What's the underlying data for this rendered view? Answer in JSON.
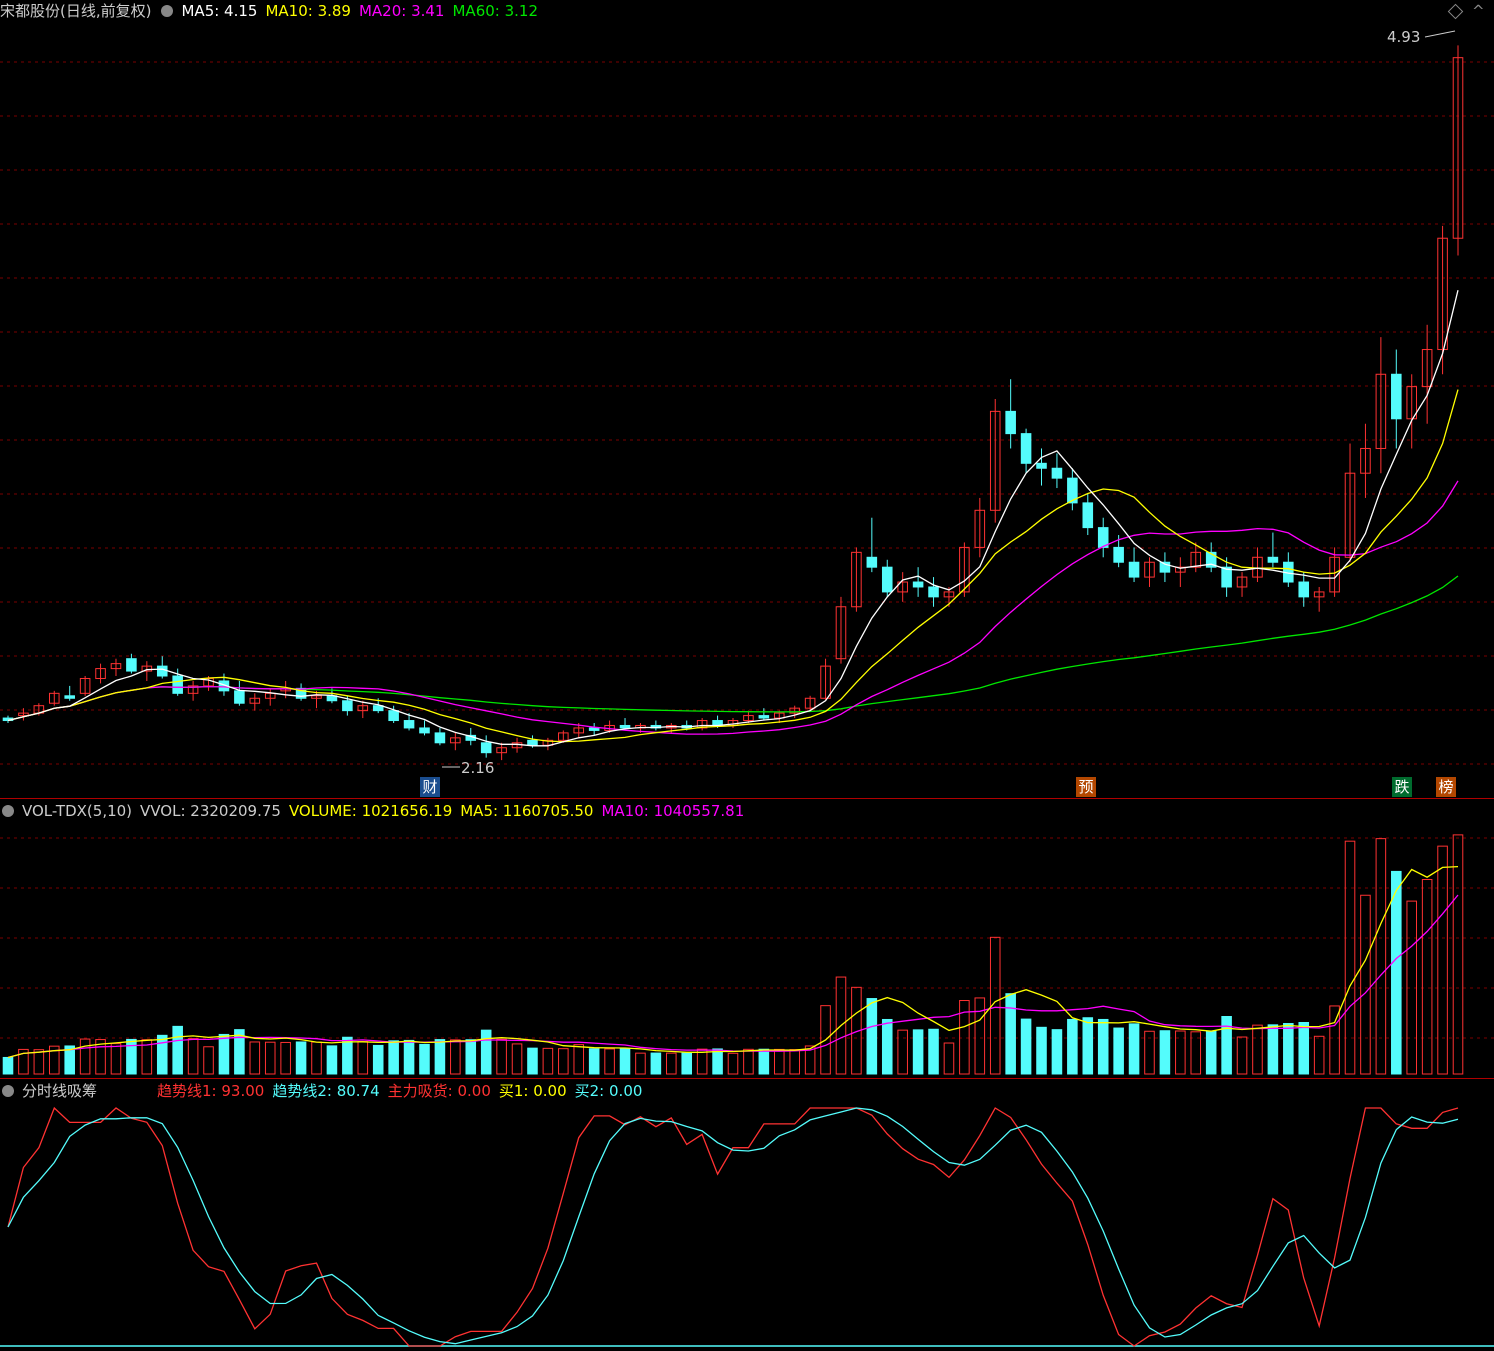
{
  "main": {
    "title": "宋都股份(日线,前复权)",
    "ma5_label": "MA5: 4.15",
    "ma10_label": "MA10: 3.89",
    "ma20_label": "MA20: 3.41",
    "ma60_label": "MA60: 3.12",
    "high_label": "4.93",
    "low_label": "2.16",
    "tag_cai": "财",
    "tag_yu": "预",
    "tag_die": "跌",
    "tag_bang": "榜",
    "colors": {
      "up": "#ff3232",
      "down": "#54fcfc",
      "ma5": "#ffffff",
      "ma10": "#ffff00",
      "ma20": "#ff00ff",
      "ma60": "#00e600",
      "grid": "#7a0000"
    }
  },
  "volume": {
    "name": "VOL-TDX(5,10)",
    "vvol_label": "VVOL: 2320209.75",
    "volume_label": "VOLUME: 1021656.19",
    "ma5_label": "MA5: 1160705.50",
    "ma10_label": "MA10: 1040557.81"
  },
  "indicator": {
    "name": "分时线吸筹",
    "trend1_label": "趋势线1: 93.00",
    "trend2_label": "趋势线2: 80.74",
    "accum_label": "主力吸货: 0.00",
    "buy1_label": "买1: 0.00",
    "buy2_label": "买2: 0.00"
  },
  "chart_data": {
    "type": "candlestick",
    "price_range": [
      2.0,
      5.0
    ],
    "candles": [
      [
        2.21,
        2.22,
        2.19,
        2.2
      ],
      [
        2.22,
        2.25,
        2.2,
        2.23
      ],
      [
        2.23,
        2.27,
        2.22,
        2.26
      ],
      [
        2.27,
        2.32,
        2.26,
        2.31
      ],
      [
        2.3,
        2.34,
        2.28,
        2.29
      ],
      [
        2.31,
        2.38,
        2.3,
        2.37
      ],
      [
        2.37,
        2.43,
        2.35,
        2.41
      ],
      [
        2.41,
        2.45,
        2.38,
        2.43
      ],
      [
        2.45,
        2.47,
        2.39,
        2.4
      ],
      [
        2.4,
        2.44,
        2.36,
        2.42
      ],
      [
        2.42,
        2.46,
        2.37,
        2.38
      ],
      [
        2.38,
        2.41,
        2.3,
        2.31
      ],
      [
        2.31,
        2.36,
        2.28,
        2.34
      ],
      [
        2.34,
        2.38,
        2.32,
        2.37
      ],
      [
        2.36,
        2.39,
        2.3,
        2.32
      ],
      [
        2.32,
        2.36,
        2.26,
        2.27
      ],
      [
        2.27,
        2.31,
        2.24,
        2.29
      ],
      [
        2.29,
        2.33,
        2.26,
        2.31
      ],
      [
        2.32,
        2.36,
        2.29,
        2.33
      ],
      [
        2.33,
        2.35,
        2.28,
        2.29
      ],
      [
        2.29,
        2.32,
        2.25,
        2.3
      ],
      [
        2.3,
        2.33,
        2.27,
        2.28
      ],
      [
        2.28,
        2.3,
        2.22,
        2.24
      ],
      [
        2.24,
        2.28,
        2.21,
        2.26
      ],
      [
        2.26,
        2.29,
        2.23,
        2.24
      ],
      [
        2.24,
        2.26,
        2.19,
        2.2
      ],
      [
        2.2,
        2.23,
        2.16,
        2.17
      ],
      [
        2.17,
        2.2,
        2.14,
        2.15
      ],
      [
        2.15,
        2.17,
        2.1,
        2.11
      ],
      [
        2.11,
        2.15,
        2.08,
        2.13
      ],
      [
        2.14,
        2.17,
        2.1,
        2.12
      ],
      [
        2.11,
        2.14,
        2.05,
        2.07
      ],
      [
        2.07,
        2.11,
        2.04,
        2.09
      ],
      [
        2.09,
        2.13,
        2.07,
        2.11
      ],
      [
        2.12,
        2.14,
        2.09,
        2.1
      ],
      [
        2.1,
        2.13,
        2.08,
        2.12
      ],
      [
        2.12,
        2.16,
        2.11,
        2.15
      ],
      [
        2.15,
        2.19,
        2.13,
        2.17
      ],
      [
        2.17,
        2.19,
        2.14,
        2.16
      ],
      [
        2.16,
        2.2,
        2.15,
        2.18
      ],
      [
        2.18,
        2.21,
        2.16,
        2.17
      ],
      [
        2.17,
        2.19,
        2.15,
        2.18
      ],
      [
        2.18,
        2.2,
        2.16,
        2.17
      ],
      [
        2.17,
        2.19,
        2.15,
        2.18
      ],
      [
        2.18,
        2.2,
        2.16,
        2.17
      ],
      [
        2.17,
        2.21,
        2.16,
        2.2
      ],
      [
        2.2,
        2.22,
        2.17,
        2.18
      ],
      [
        2.18,
        2.21,
        2.17,
        2.2
      ],
      [
        2.2,
        2.24,
        2.19,
        2.22
      ],
      [
        2.22,
        2.25,
        2.2,
        2.21
      ],
      [
        2.21,
        2.24,
        2.19,
        2.23
      ],
      [
        2.23,
        2.26,
        2.21,
        2.25
      ],
      [
        2.25,
        2.3,
        2.24,
        2.29
      ],
      [
        2.29,
        2.45,
        2.28,
        2.42
      ],
      [
        2.45,
        2.7,
        2.43,
        2.66
      ],
      [
        2.66,
        2.9,
        2.64,
        2.88
      ],
      [
        2.86,
        3.02,
        2.8,
        2.82
      ],
      [
        2.82,
        2.85,
        2.7,
        2.72
      ],
      [
        2.72,
        2.8,
        2.68,
        2.76
      ],
      [
        2.76,
        2.82,
        2.7,
        2.74
      ],
      [
        2.74,
        2.78,
        2.66,
        2.7
      ],
      [
        2.7,
        2.74,
        2.66,
        2.72
      ],
      [
        2.72,
        2.92,
        2.7,
        2.9
      ],
      [
        2.9,
        3.1,
        2.86,
        3.05
      ],
      [
        3.05,
        3.5,
        3.0,
        3.45
      ],
      [
        3.45,
        3.58,
        3.3,
        3.36
      ],
      [
        3.36,
        3.38,
        3.2,
        3.24
      ],
      [
        3.24,
        3.3,
        3.15,
        3.22
      ],
      [
        3.22,
        3.28,
        3.14,
        3.18
      ],
      [
        3.18,
        3.22,
        3.05,
        3.08
      ],
      [
        3.08,
        3.12,
        2.95,
        2.98
      ],
      [
        2.98,
        3.02,
        2.86,
        2.9
      ],
      [
        2.9,
        2.95,
        2.82,
        2.84
      ],
      [
        2.84,
        2.9,
        2.76,
        2.78
      ],
      [
        2.78,
        2.86,
        2.74,
        2.84
      ],
      [
        2.84,
        2.88,
        2.76,
        2.8
      ],
      [
        2.8,
        2.86,
        2.74,
        2.82
      ],
      [
        2.82,
        2.92,
        2.8,
        2.88
      ],
      [
        2.88,
        2.92,
        2.8,
        2.82
      ],
      [
        2.82,
        2.86,
        2.7,
        2.74
      ],
      [
        2.74,
        2.8,
        2.7,
        2.78
      ],
      [
        2.78,
        2.9,
        2.76,
        2.86
      ],
      [
        2.86,
        2.96,
        2.82,
        2.84
      ],
      [
        2.84,
        2.88,
        2.74,
        2.76
      ],
      [
        2.76,
        2.8,
        2.66,
        2.7
      ],
      [
        2.7,
        2.74,
        2.64,
        2.72
      ],
      [
        2.72,
        2.9,
        2.7,
        2.86
      ],
      [
        2.86,
        3.32,
        2.84,
        3.2
      ],
      [
        3.2,
        3.4,
        3.1,
        3.3
      ],
      [
        3.3,
        3.75,
        3.2,
        3.6
      ],
      [
        3.6,
        3.7,
        3.3,
        3.42
      ],
      [
        3.42,
        3.6,
        3.3,
        3.55
      ],
      [
        3.55,
        3.8,
        3.4,
        3.7
      ],
      [
        3.7,
        4.2,
        3.6,
        4.15
      ],
      [
        4.15,
        4.93,
        4.08,
        4.88
      ]
    ],
    "volume_range": [
      0,
      2400000
    ]
  }
}
